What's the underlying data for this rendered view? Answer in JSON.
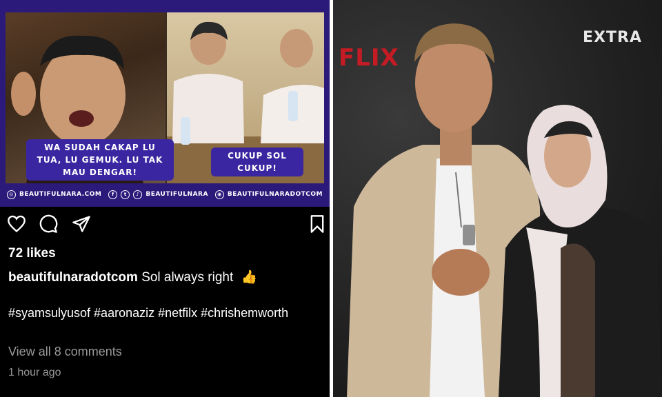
{
  "post": {
    "image": {
      "caption_left": "WA SUDAH CAKAP LU TUA, LU GEMUK. LU TAK MAU DENGAR!",
      "caption_right": "CUKUP SOL CUKUP!",
      "footer": {
        "website": "BEAUTIFULNARA.COM",
        "handle": "BEAUTIFULNARA",
        "instagram": "BEAUTIFULNARADOTCOM"
      }
    },
    "likes": "72 likes",
    "caption": {
      "username": "beautifulnaradotcom",
      "text": "Sol always right",
      "emoji": "👍"
    },
    "hashtags": "#syamsulyusof #aaronaziz #netfilx #chrishemworth",
    "view_comments": "View all 8 comments",
    "timestamp": "1 hour ago",
    "icons": [
      "heart-icon",
      "comment-icon",
      "share-icon",
      "bookmark-icon"
    ],
    "colors": {
      "background": "#000000",
      "banner": "#2b1a7a",
      "muted_text": "#9a9a9a"
    }
  },
  "photo": {
    "backdrop_logo": "FLIX",
    "event_logo": "EXTRA",
    "colors": {
      "netflix_red": "#c41b25"
    }
  }
}
